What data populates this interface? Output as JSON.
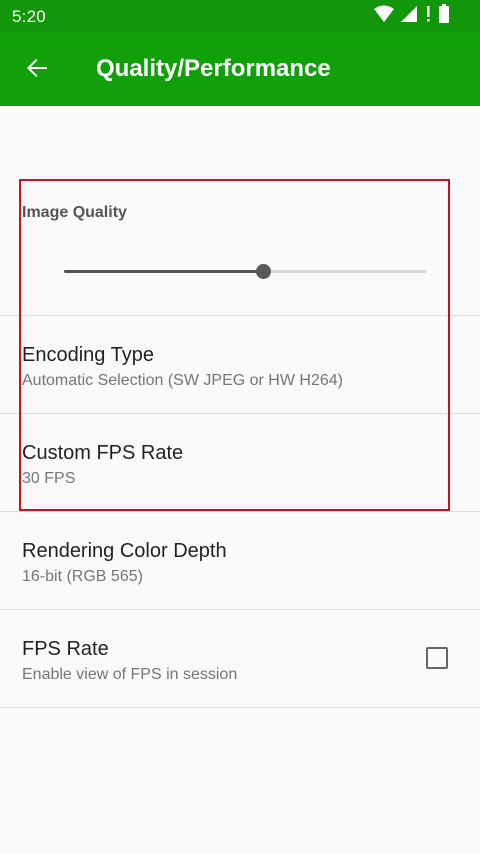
{
  "status_bar": {
    "time": "5:20",
    "icons": [
      "wifi-icon",
      "signal-icon",
      "notification-icon",
      "battery-icon"
    ]
  },
  "app_bar": {
    "title": "Quality/Performance",
    "back_icon": "back-arrow-icon",
    "color": "#12a00a"
  },
  "image_quality": {
    "title": "Image Quality",
    "slider_value_fraction": 0.55
  },
  "preferences": [
    {
      "title": "Encoding Type",
      "summary": "Automatic Selection (SW JPEG or HW H264)"
    },
    {
      "title": "Custom FPS Rate",
      "summary": "30 FPS"
    },
    {
      "title": "Rendering Color Depth",
      "summary": "16-bit (RGB 565)"
    },
    {
      "title": "FPS Rate",
      "summary": "Enable view of FPS in session",
      "checked": false
    }
  ],
  "highlight_color": "#d01020"
}
